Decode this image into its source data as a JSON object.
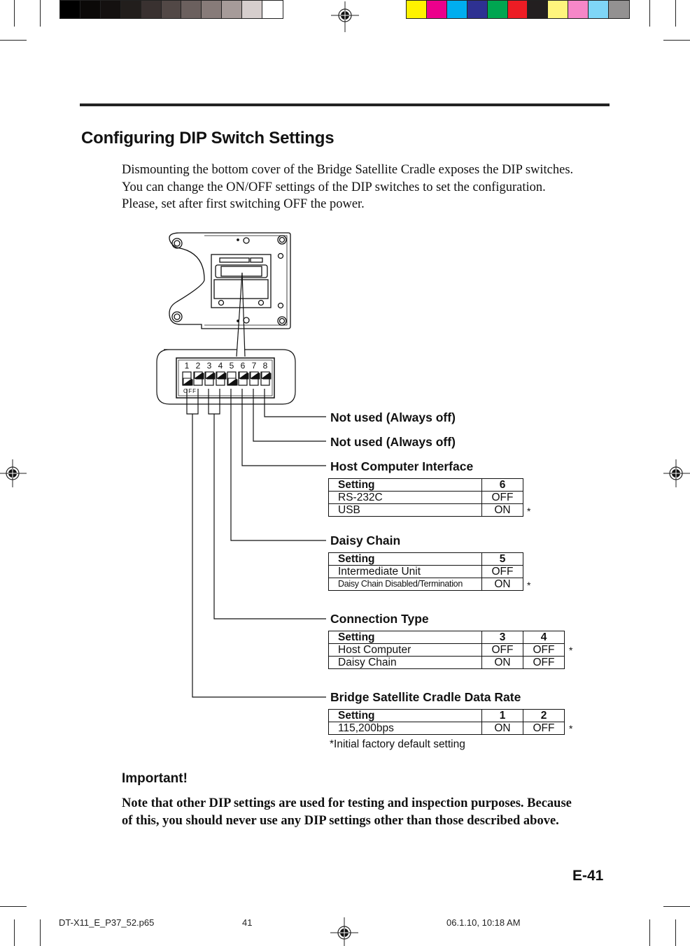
{
  "print_marks": {
    "gray_swatches": [
      "#000000",
      "#0b0908",
      "#141110",
      "#221e1c",
      "#393130",
      "#524846",
      "#6b605e",
      "#877b79",
      "#a69b99",
      "#d6cecd",
      "#ffffff"
    ],
    "color_swatches": [
      "#fff200",
      "#ec008c",
      "#00aeef",
      "#2e3192",
      "#00a651",
      "#ed1c24",
      "#231f20",
      "#fff57d",
      "#f687c8",
      "#7fd6f7",
      "#939191"
    ],
    "slug": {
      "filename": "DT-X11_E_P37_52.p65",
      "page": "41",
      "timestamp": "06.1.10, 10:18 AM"
    }
  },
  "section": {
    "title": "Configuring DIP Switch Settings",
    "intro": [
      "Dismounting the bottom cover of the Bridge Satellite Cradle exposes the DIP switches.",
      "You can change the ON/OFF settings of the DIP switches to set the configuration.",
      "Please, set after first switching OFF the power."
    ]
  },
  "figure": {
    "switch_numbers": [
      "1",
      "2",
      "3",
      "4",
      "5",
      "6",
      "7",
      "8"
    ],
    "off_label": "OFF",
    "switch_states": [
      "ON",
      "OFF",
      "OFF",
      "OFF",
      "ON",
      "OFF",
      "OFF",
      "OFF"
    ]
  },
  "callouts": {
    "switch8": {
      "label": "Not used (Always off)"
    },
    "switch7": {
      "label": "Not used (Always off)"
    },
    "host_interface": {
      "label": "Host Computer Interface",
      "header": [
        "Setting",
        "6"
      ],
      "rows": [
        {
          "name": "RS-232C",
          "values": [
            "OFF"
          ],
          "default": false
        },
        {
          "name": "USB",
          "values": [
            "ON"
          ],
          "default": true
        }
      ]
    },
    "daisy_chain": {
      "label": "Daisy Chain",
      "header": [
        "Setting",
        "5"
      ],
      "rows": [
        {
          "name": "Intermediate Unit",
          "values": [
            "OFF"
          ],
          "default": false
        },
        {
          "name": "Daisy Chain Disabled/Termination",
          "values": [
            "ON"
          ],
          "default": true
        }
      ]
    },
    "connection_type": {
      "label": "Connection Type",
      "header": [
        "Setting",
        "3",
        "4"
      ],
      "rows": [
        {
          "name": "Host Computer",
          "values": [
            "OFF",
            "OFF"
          ],
          "default": true
        },
        {
          "name": "Daisy Chain",
          "values": [
            "ON",
            "OFF"
          ],
          "default": false
        }
      ]
    },
    "data_rate": {
      "label": "Bridge Satellite Cradle Data Rate",
      "header": [
        "Setting",
        "1",
        "2"
      ],
      "rows": [
        {
          "name": "115,200bps",
          "values": [
            "ON",
            "OFF"
          ],
          "default": true
        }
      ]
    },
    "default_marker": "*",
    "footnote": "*Initial factory default setting"
  },
  "important": {
    "heading": "Important!",
    "lines": [
      "Note that other DIP settings are used for testing and inspection purposes. Because",
      "of this, you should never use any DIP settings other than those described above."
    ]
  },
  "page_number": "E-41"
}
